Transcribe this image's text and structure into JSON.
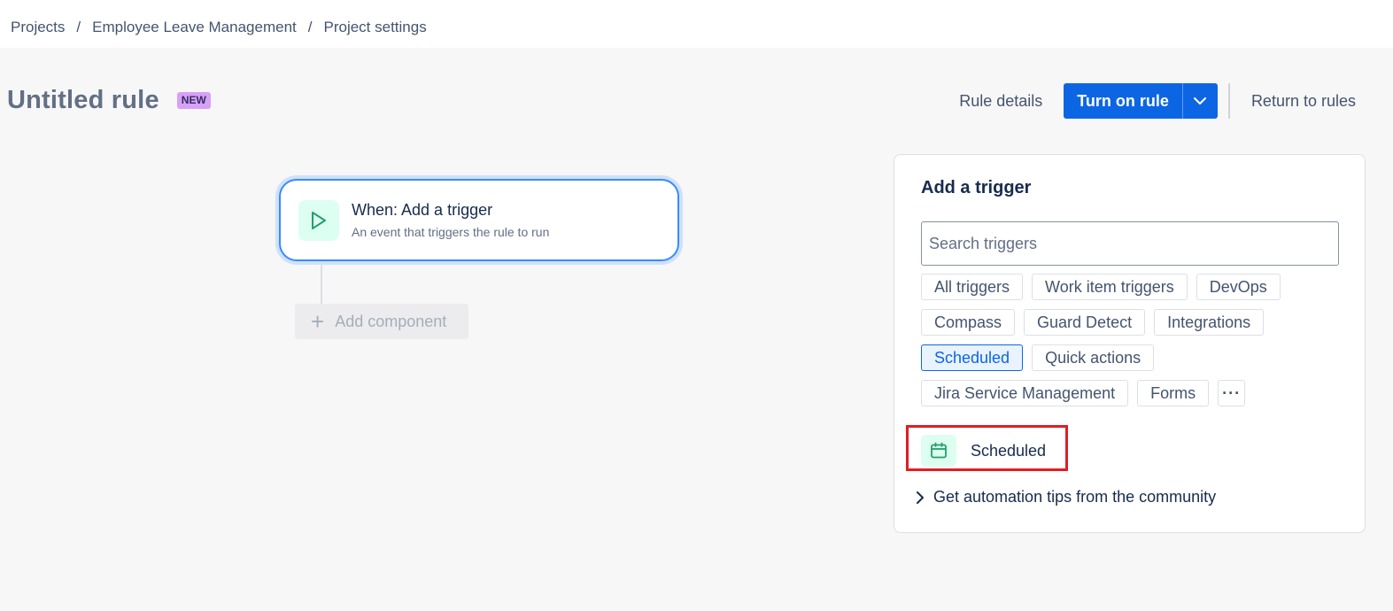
{
  "breadcrumb": {
    "items": [
      "Projects",
      "Employee Leave Management",
      "Project settings"
    ],
    "separator": "/"
  },
  "rule": {
    "title": "Untitled rule",
    "badge": "NEW"
  },
  "header": {
    "rule_details": "Rule details",
    "turn_on": "Turn on rule",
    "return_to_rules": "Return to rules"
  },
  "canvas": {
    "trigger_title": "When: Add a trigger",
    "trigger_subtitle": "An event that triggers the rule to run",
    "trigger_icon": "play-icon",
    "add_component": "Add component"
  },
  "panel": {
    "title": "Add a trigger",
    "search_placeholder": "Search triggers",
    "chips_row1": [
      "All triggers",
      "Work item triggers",
      "DevOps"
    ],
    "chips_row2": [
      "Compass",
      "Guard Detect",
      "Integrations"
    ],
    "chips_row3": [
      "Scheduled",
      "Quick actions"
    ],
    "chips_row4": [
      "Jira Service Management",
      "Forms"
    ],
    "more_label": "···",
    "selected_chip": "Scheduled",
    "result": {
      "label": "Scheduled",
      "icon": "calendar-icon"
    },
    "tips": "Get automation tips from the community"
  },
  "colors": {
    "primary": "#0c66e4",
    "badge": "#d8a0f7",
    "highlight": "#e11d24",
    "icon_green": "#22a06b"
  }
}
